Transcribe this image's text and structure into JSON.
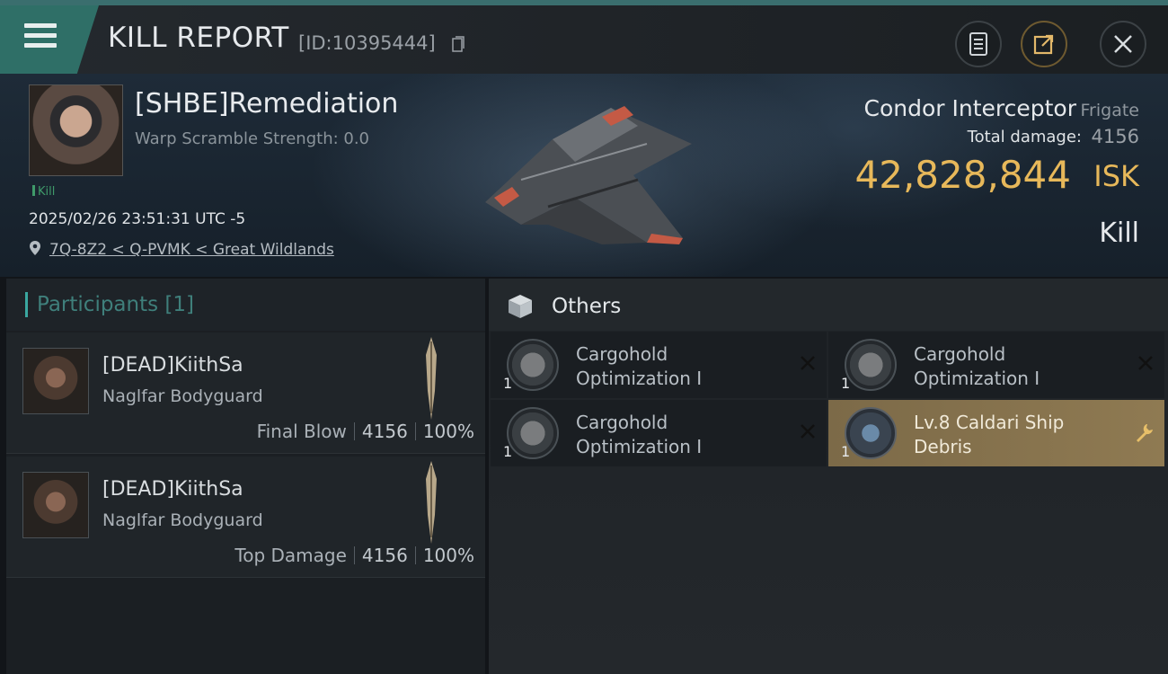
{
  "header": {
    "title": "KILL REPORT",
    "kill_id": "[ID:10395444]"
  },
  "victim": {
    "pilot_name": "[SHBE]Remediation",
    "warp_scramble": "Warp Scramble Strength: 0.0",
    "tag": "Kill",
    "datetime": "2025/02/26 23:51:31 UTC -5",
    "location": "7Q-8Z2 < Q-PVMK < Great Wildlands",
    "ship_name": "Condor Interceptor",
    "ship_class": "Frigate",
    "total_damage_label": "Total damage:",
    "total_damage": "4156",
    "isk_value": "42,828,844",
    "isk_unit": "ISK",
    "result": "Kill"
  },
  "participants": {
    "title": "Participants [1]",
    "rows": [
      {
        "name": "[DEAD]KiithSa",
        "corp": "Naglfar Bodyguard",
        "label": "Final Blow",
        "damage": "4156",
        "percent": "100%"
      },
      {
        "name": "[DEAD]KiithSa",
        "corp": "Naglfar Bodyguard",
        "label": "Top Damage",
        "damage": "4156",
        "percent": "100%"
      }
    ]
  },
  "others": {
    "title": "Others",
    "items": [
      {
        "qty": "1",
        "name": "Cargohold Optimization I",
        "icon": "cargohold-module-icon",
        "action": "close-icon"
      },
      {
        "qty": "1",
        "name": "Cargohold Optimization I",
        "icon": "cargohold-module-icon",
        "action": "close-icon"
      },
      {
        "qty": "1",
        "name": "Cargohold Optimization I",
        "icon": "cargohold-module-icon",
        "action": "close-icon"
      },
      {
        "qty": "1",
        "name": "Lv.8 Caldari Ship Debris",
        "icon": "ship-debris-icon",
        "action": "wrench-icon"
      }
    ]
  },
  "colors": {
    "accent_teal": "#3aa7a0",
    "isk_gold": "#e7b85a",
    "highlight_item": "#8f7a52"
  }
}
